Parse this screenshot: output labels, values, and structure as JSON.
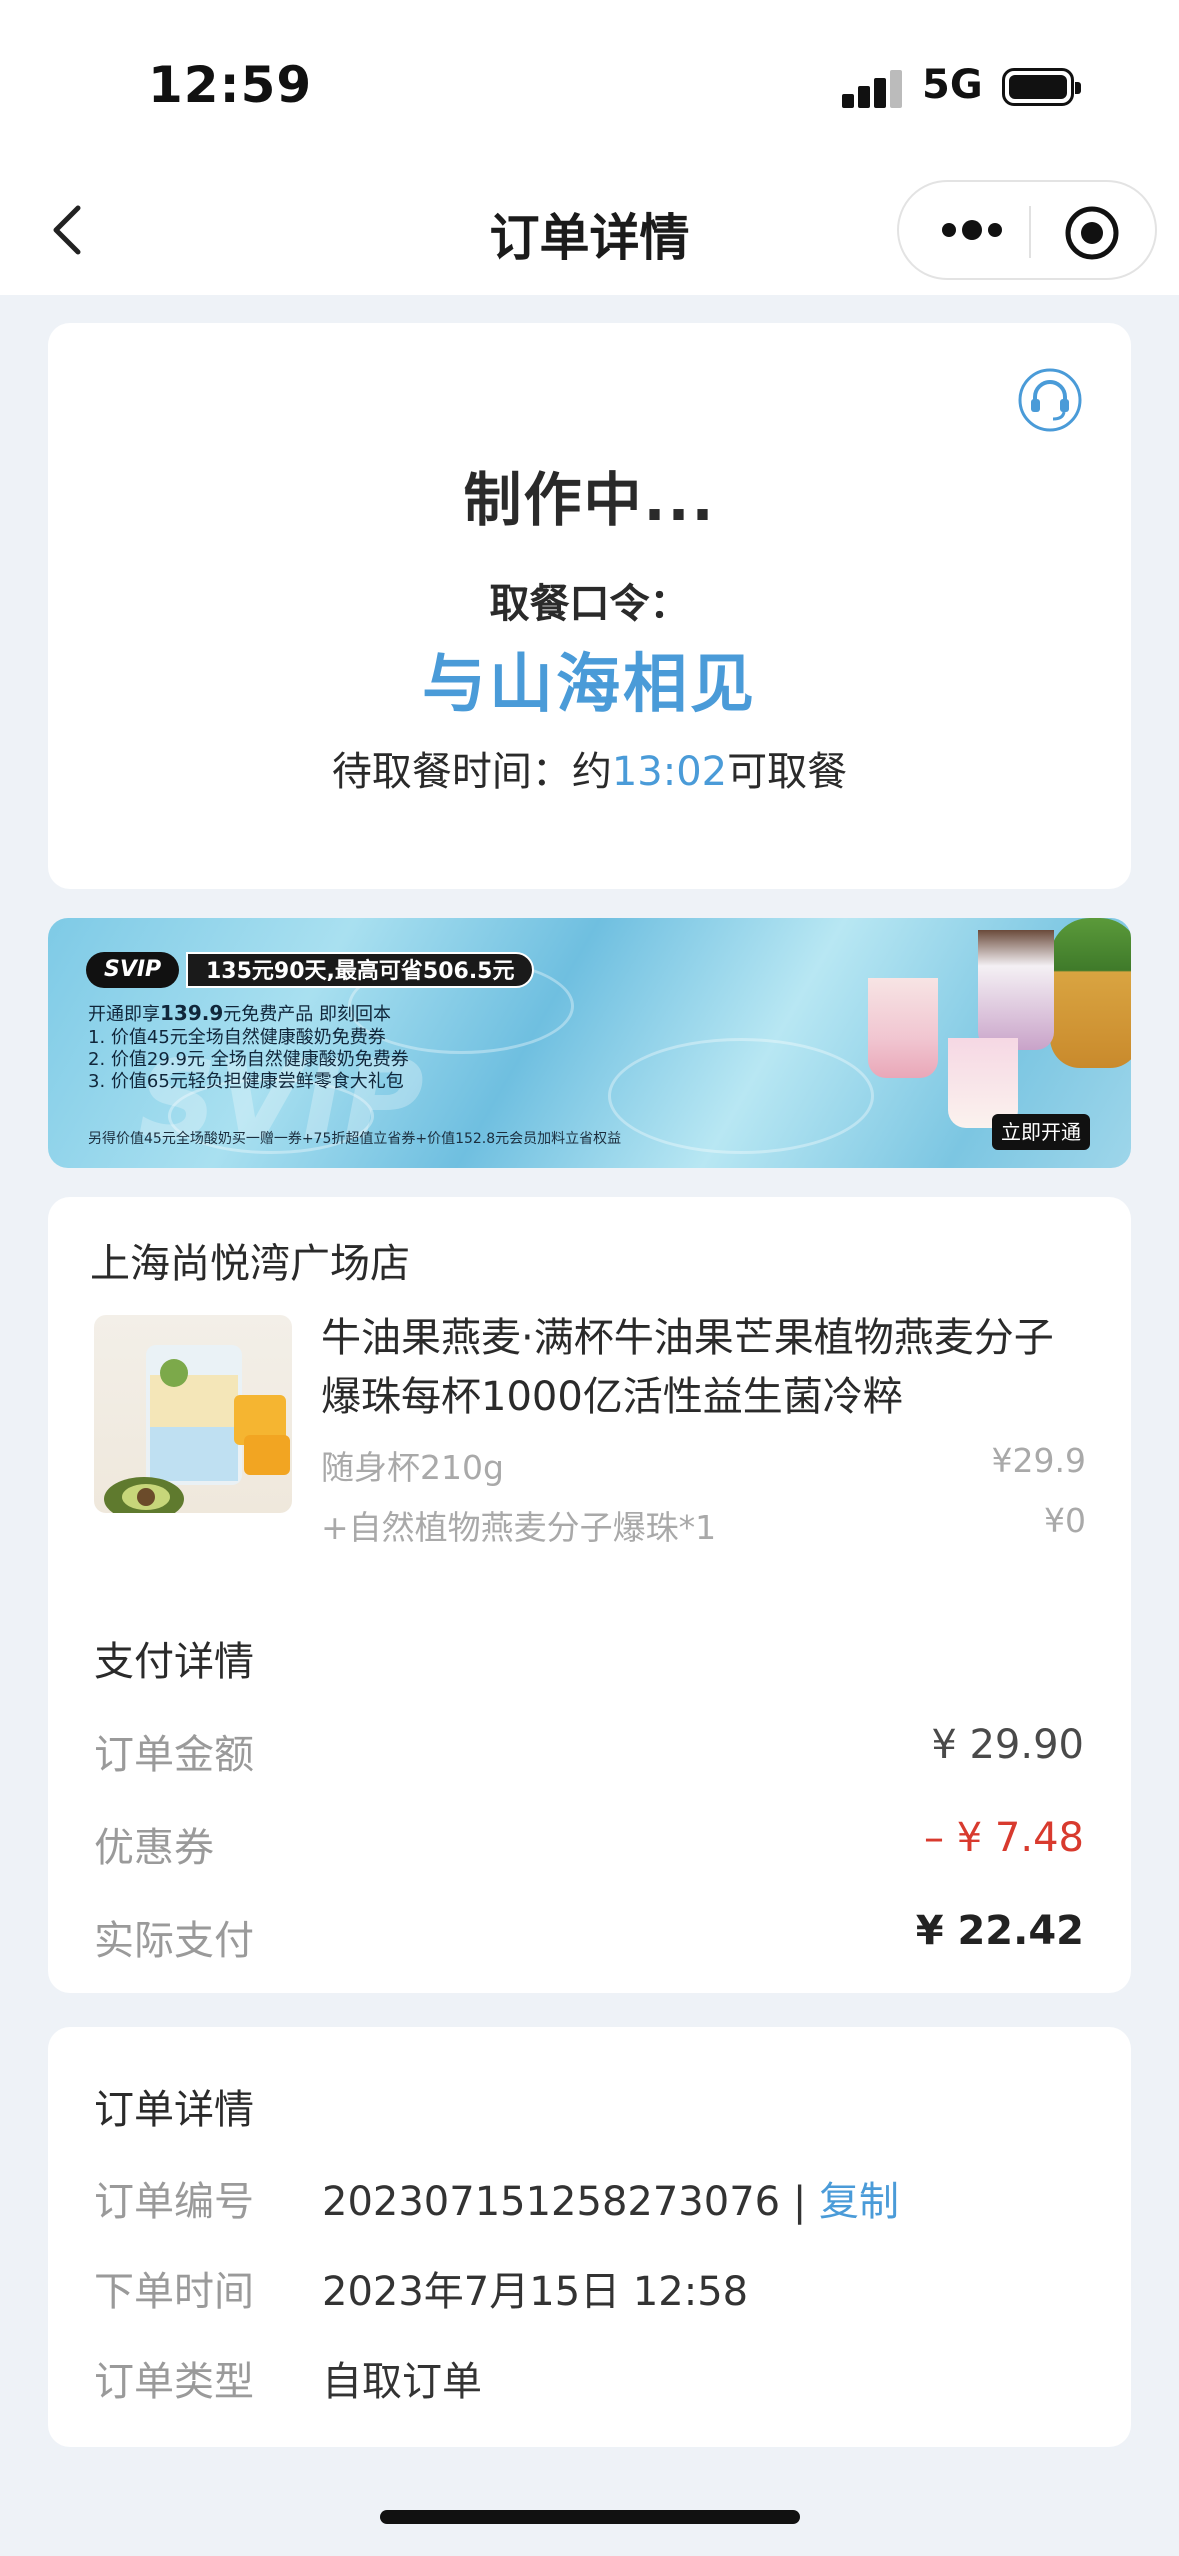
{
  "status_bar": {
    "time": "12:59",
    "network": "5G"
  },
  "nav": {
    "title": "订单详情"
  },
  "status_card": {
    "title": "制作中...",
    "code_label": "取餐口令：",
    "code_value": "与山海相见",
    "pickup_prefix": "待取餐时间：约",
    "pickup_time": "13:02",
    "pickup_suffix": "可取餐"
  },
  "banner": {
    "svip_tag": "SVIP",
    "promo_tag": "135元90天,最高可省506.5元",
    "line1_prefix": "开通即享",
    "line1_amount": "139.9",
    "line1_suffix": "元免费产品 即刻回本",
    "line2": "1. 价值45元全场自然健康酸奶免费券",
    "line3": "2. 价值29.9元 全场自然健康酸奶免费券",
    "line4": "3. 价值65元轻负担健康尝鲜零食大礼包",
    "footnote": "另得价值45元全场酸奶买一赠一券+75折超值立省券+价值152.8元会员加料立省权益",
    "watermark": "SVIP",
    "open_button": "立即开通"
  },
  "order": {
    "store": "上海尚悦湾广场店",
    "product_name": "牛油果燕麦·满杯牛油果芒果植物燕麦分子爆珠每杯1000亿活性益生菌冷粹",
    "spec1": "随身杯210g",
    "spec1_price": "¥29.9",
    "spec2": "+自然植物燕麦分子爆珠*1",
    "spec2_price": "¥0"
  },
  "payment": {
    "title": "支付详情",
    "rows": [
      {
        "label": "订单金额",
        "value": "¥ 29.90"
      },
      {
        "label": "优惠券",
        "value": "– ¥ 7.48"
      },
      {
        "label": "实际支付",
        "value": "¥ 22.42"
      }
    ]
  },
  "details": {
    "title": "订单详情",
    "order_no_label": "订单编号",
    "order_no": "2023071512582730 76",
    "separator": "|",
    "copy": "复制",
    "time_label": "下单时间",
    "time_value": "2023年7月15日 12:58",
    "type_label": "订单类型",
    "type_value": "自取订单"
  },
  "colors": {
    "accent": "#4a9bd8",
    "discount": "#d83a2e",
    "background": "#eef2f7"
  }
}
